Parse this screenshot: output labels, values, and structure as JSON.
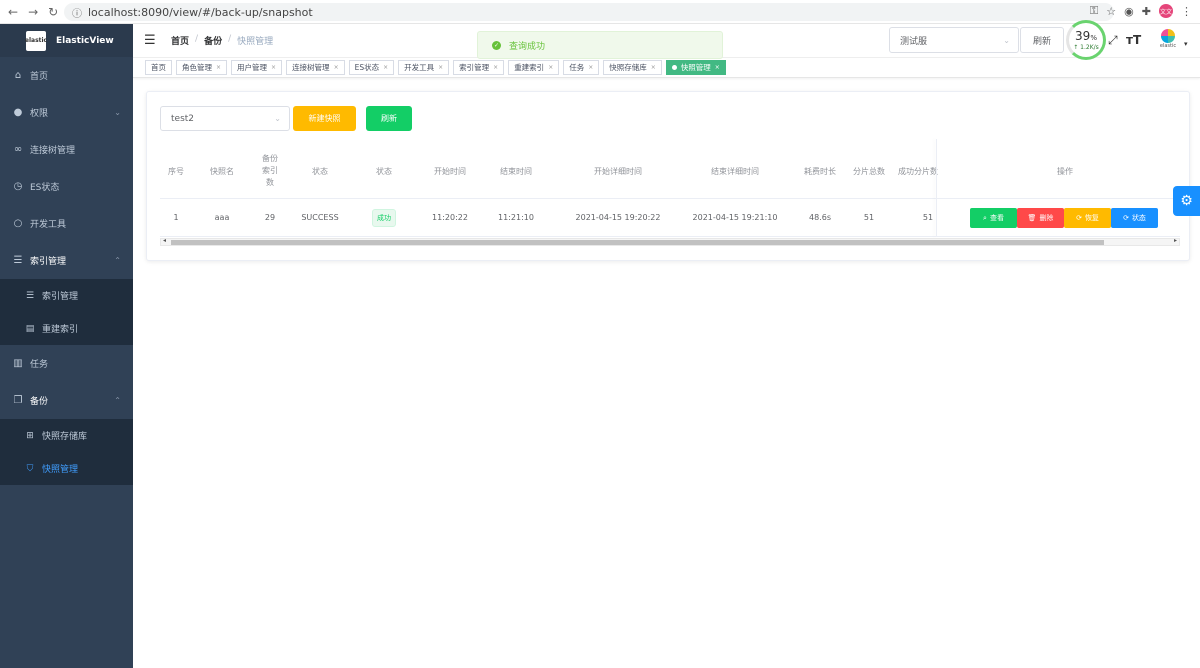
{
  "browser": {
    "url": "localhost:8090/view/#/back-up/snapshot",
    "ext_avatar": "文文"
  },
  "sidebar": {
    "app_name": "ElasticView",
    "logo_text": "elastic",
    "items": [
      {
        "label": "首页",
        "icon": "home-icon"
      },
      {
        "label": "权限",
        "icon": "user-icon"
      },
      {
        "label": "连接树管理",
        "icon": "link-icon"
      },
      {
        "label": "ES状态",
        "icon": "clock-icon"
      },
      {
        "label": "开发工具",
        "icon": "search-icon"
      },
      {
        "label": "索引管理",
        "icon": "database-icon"
      },
      {
        "label": "索引管理",
        "icon": "database-icon"
      },
      {
        "label": "重建索引",
        "icon": "copy-icon"
      },
      {
        "label": "任务",
        "icon": "document-icon"
      },
      {
        "label": "备份",
        "icon": "copy-icon"
      },
      {
        "label": "快照存储库",
        "icon": "box-icon"
      },
      {
        "label": "快照管理",
        "icon": "bag-icon"
      }
    ]
  },
  "header": {
    "breadcrumb": [
      "首页",
      "备份",
      "快照管理"
    ],
    "env_select": "测试服",
    "refresh_label": "刷新",
    "gauge_pct": "39",
    "gauge_unit": "%",
    "gauge_speed": "↑ 1.2K/s",
    "gauge_value": 0.39,
    "elastic_label": "elastic"
  },
  "toast": {
    "message": "查询成功",
    "color": "#67c23a"
  },
  "tags": [
    "首页",
    "角色管理",
    "用户管理",
    "连接树管理",
    "ES状态",
    "开发工具",
    "索引管理",
    "重建索引",
    "任务",
    "快照存储库",
    "快照管理"
  ],
  "toolbar": {
    "repo_value": "test2",
    "new_label": "新建快照",
    "refresh_label": "刷新"
  },
  "table": {
    "headers": {
      "index": "序号",
      "name": "快照名",
      "indices_count": "备份索引数",
      "state": "状态",
      "state2": "状态",
      "start": "开始时间",
      "end": "结束时间",
      "start_detail": "开始详细时间",
      "end_detail": "结束详细时间",
      "duration": "耗费时长",
      "shards_total": "分片总数",
      "shards_success": "成功分片数",
      "ops": "操作"
    },
    "rows": [
      {
        "index": "1",
        "name": "aaa",
        "indices_count": "29",
        "state": "SUCCESS",
        "state_tag": "成功",
        "start": "11:20:22",
        "end": "11:21:10",
        "start_detail": "2021-04-15 19:20:22",
        "end_detail": "2021-04-15 19:21:10",
        "duration": "48.6s",
        "shards_total": "51",
        "shards_success": "51",
        "ops": {
          "view": "查看",
          "delete": "删除",
          "restore": "恢复",
          "status": "状态"
        }
      }
    ]
  },
  "colors": {
    "sidebar_bg": "#304156",
    "accent": "#409eff",
    "success": "#13ce66",
    "warning": "#ffba00",
    "danger": "#ff4949",
    "primary": "#1890ff",
    "tag_active": "#42b983"
  }
}
